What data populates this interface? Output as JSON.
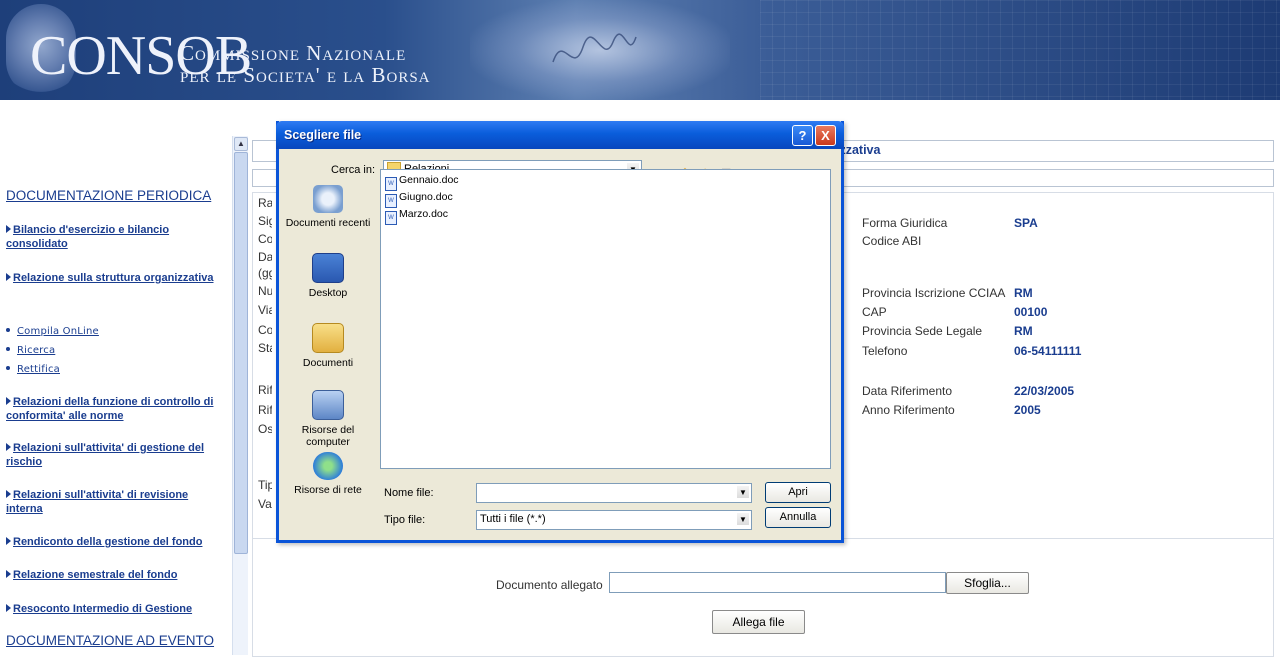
{
  "header": {
    "brand": "CONSOB",
    "commission_line1": "Commissione Nazionale",
    "commission_line2": "per le Societa' e la Borsa"
  },
  "sidebar": {
    "section1_title": "DOCUMENTAZIONE PERIODICA",
    "items": [
      {
        "label": "Bilancio d'esercizio e bilancio consolidato"
      },
      {
        "label": "Relazione sulla struttura organizzativa"
      },
      {
        "label": "Relazioni della funzione di controllo di conformita' alle norme"
      },
      {
        "label": "Relazioni sull'attivita' di gestione del rischio"
      },
      {
        "label": "Relazioni sull'attivita' di revisione interna"
      },
      {
        "label": "Rendiconto della gestione del fondo"
      },
      {
        "label": "Relazione semestrale del fondo"
      },
      {
        "label": "Resoconto Intermedio di Gestione"
      }
    ],
    "subitems": [
      {
        "label": "Compila OnLine"
      },
      {
        "label": "Ricerca"
      },
      {
        "label": "Rettifica"
      }
    ],
    "section2_title": "DOCUMENTAZIONE AD EVENTO"
  },
  "main": {
    "section_title_fragment": "izzativa",
    "left_labels_cut": [
      "Rag",
      "Sig",
      "Cod",
      "Dat",
      "(gg",
      "Nur",
      "Via/",
      "Cor",
      "Sta",
      "Rife",
      "Rife",
      "Oss",
      "Tipo",
      "Var"
    ],
    "right_fields": [
      {
        "label": "Forma Giuridica",
        "value": "SPA"
      },
      {
        "label": "Codice ABI",
        "value": ""
      },
      {
        "label": "Provincia Iscrizione CCIAA",
        "value": "RM"
      },
      {
        "label": "CAP",
        "value": "00100"
      },
      {
        "label": "Provincia Sede Legale",
        "value": "RM"
      },
      {
        "label": "Telefono",
        "value": "06-54111111"
      },
      {
        "label": "Data Riferimento",
        "value": "22/03/2005"
      },
      {
        "label": "Anno Riferimento",
        "value": "2005"
      }
    ],
    "attachment_label": "Documento allegato",
    "attachment_value": "",
    "browse_button": "Sfoglia...",
    "attach_button": "Allega file"
  },
  "dialog": {
    "title": "Scegliere file",
    "look_in_label": "Cerca in:",
    "look_in_value": "Relazioni",
    "places": [
      {
        "label": "Documenti recenti",
        "icon": "recent-documents-icon"
      },
      {
        "label": "Desktop",
        "icon": "desktop-icon"
      },
      {
        "label": "Documenti",
        "icon": "my-documents-icon"
      },
      {
        "label": "Risorse del computer",
        "icon": "my-computer-icon"
      },
      {
        "label": "Risorse di rete",
        "icon": "network-icon"
      }
    ],
    "files": [
      "Gennaio.doc",
      "Giugno.doc",
      "Marzo.doc"
    ],
    "filename_label": "Nome file:",
    "filename_value": "",
    "filetype_label": "Tipo file:",
    "filetype_value": "Tutti i file (*.*)",
    "open_button": "Apri",
    "cancel_button": "Annulla",
    "help_button": "?",
    "close_button": "X",
    "colors": {
      "titlebar": "#0a5ddb",
      "body": "#ece9d8",
      "close": "#c9391c"
    }
  }
}
